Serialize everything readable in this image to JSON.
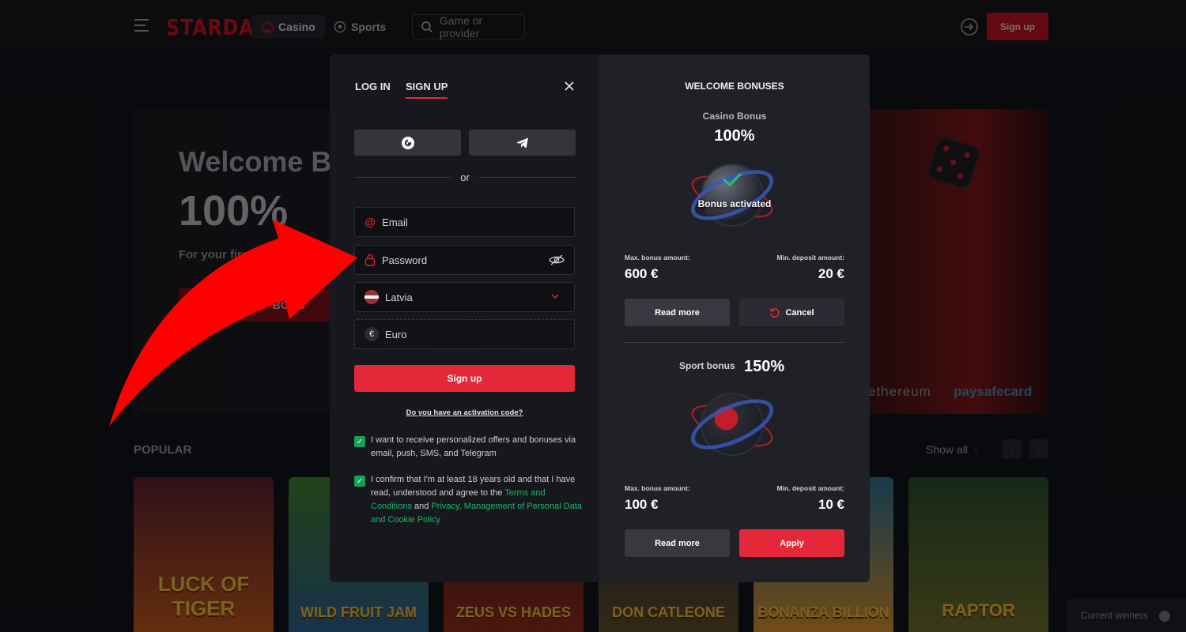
{
  "topnav": {
    "logo": "STARDA",
    "casino_tab": "Casino",
    "sports_tab": "Sports",
    "search_placeholder": "Game or provider",
    "signup_label": "Sign up"
  },
  "banner": {
    "title": "Welcome B",
    "percent": "100%",
    "subtitle": "For your first",
    "button": "BONU",
    "pay_eth": "ethereum",
    "pay_psc": "paysafecard"
  },
  "popular": {
    "title": "POPULAR",
    "show_all": "Show all",
    "games": [
      "LUCK OF TIGER",
      "WILD FRUIT JAM",
      "ZEUS VS HADES",
      "DON CATLEONE",
      "BONANZA BILLION",
      "RAPTOR"
    ]
  },
  "winners": "Current winners",
  "modal": {
    "tab_login": "LOG IN",
    "tab_signup": "SIGN UP",
    "or": "or",
    "email_placeholder": "Email",
    "password_placeholder": "Password",
    "country": "Latvia",
    "currency": "Euro",
    "signup_button": "Sign up",
    "activation_link": "Do you have an activation code?",
    "consent_offers": "I want to receive personalized offers and bonuses via email, push, SMS, and Telegram",
    "consent_age_pre": "I confirm that I'm at least 18 years old and that I have read, understood and agree to the ",
    "consent_terms": "Terms and Conditions",
    "consent_and": " and ",
    "consent_privacy": "Privacy, Management of Personal Data and Cookie Policy"
  },
  "bonuses": {
    "title": "WELCOME BONUSES",
    "casino": {
      "label": "Casino Bonus",
      "percent": "100%",
      "status": "Bonus activated",
      "max_label": "Max. bonus amount:",
      "max_value": "600 €",
      "min_label": "Min. deposit amount:",
      "min_value": "20 €",
      "read_more": "Read more",
      "cancel": "Cancel"
    },
    "sport": {
      "label": "Sport bonus",
      "percent": "150%",
      "max_label": "Max. bonus amount:",
      "max_value": "100 €",
      "min_label": "Min. deposit amount:",
      "min_value": "10 €",
      "read_more": "Read more",
      "apply": "Apply"
    }
  },
  "colors": {
    "accent": "#e5273a",
    "check": "#16a05a",
    "annotation_arrow": "#ff0000"
  }
}
